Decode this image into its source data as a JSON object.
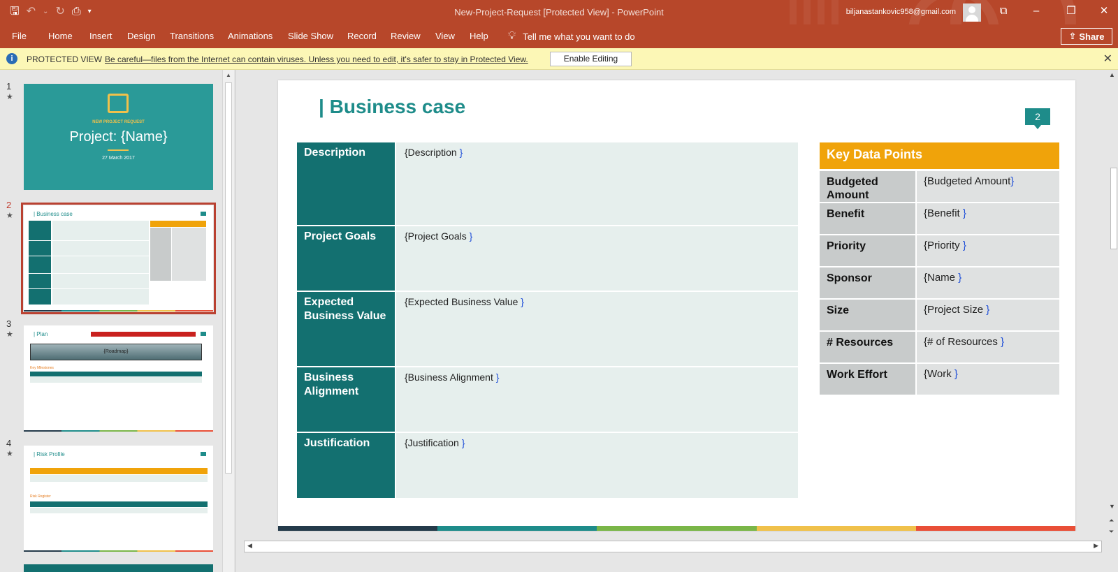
{
  "titlebar": {
    "document_title": "New-Project-Request  [Protected View]  -  PowerPoint",
    "user_email": "biljanastankovic958@gmail.com",
    "icons": [
      "save-icon",
      "undo-icon",
      "redo-icon",
      "present-icon",
      "customize-icon"
    ]
  },
  "ribbon": {
    "tabs": [
      "File",
      "Home",
      "Insert",
      "Design",
      "Transitions",
      "Animations",
      "Slide Show",
      "Record",
      "Review",
      "View",
      "Help"
    ],
    "tell_me": "Tell me what you want to do",
    "share_label": "Share"
  },
  "protected_view": {
    "label": "PROTECTED VIEW",
    "message": "Be careful—files from the Internet can contain viruses. Unless you need to edit, it's safer to stay in Protected View.",
    "enable_label": "Enable Editing"
  },
  "thumbnails": {
    "numbers": [
      "1",
      "2",
      "3",
      "4"
    ],
    "star": "★",
    "slide1": {
      "subtitle": "NEW PROJECT REQUEST",
      "title": "Project: {Name}",
      "date": "27 March 2017"
    },
    "slide2": {
      "title": "| Business case"
    },
    "slide3": {
      "title": "| Plan",
      "roadmap": "{Roadmap}",
      "milestone": "Key Milestones"
    },
    "slide4": {
      "title": "| Risk Profile",
      "register": "Risk Register"
    }
  },
  "slide": {
    "title": "| Business case",
    "page_badge": "2",
    "business_case": [
      {
        "label": "Description",
        "value": "{Description }"
      },
      {
        "label": "Project Goals",
        "value": "{Project Goals }"
      },
      {
        "label": "Expected Business Value",
        "value": "{Expected Business Value }"
      },
      {
        "label": "Business Alignment",
        "value": "{Business Alignment }"
      },
      {
        "label": "Justification",
        "value": "{Justification }"
      }
    ],
    "key_data_title": "Key Data Points",
    "key_data": [
      {
        "label": "Budgeted Amount",
        "value": "{Budgeted Amount}"
      },
      {
        "label": "Benefit",
        "value": "{Benefit }"
      },
      {
        "label": "Priority",
        "value": "{Priority }"
      },
      {
        "label": "Sponsor",
        "value": "{Name }"
      },
      {
        "label": "Size",
        "value": "{Project Size }"
      },
      {
        "label": "# Resources",
        "value": "{# of Resources }"
      },
      {
        "label": "Work Effort",
        "value": "{Work }"
      }
    ],
    "stripe_colors": [
      "#243a4a",
      "#1e8c8a",
      "#7ab648",
      "#f0c14b",
      "#e94f37"
    ]
  },
  "colors": {
    "titlebar": "#b7472a",
    "teal": "#137070",
    "accent_orange": "#f0a30a",
    "protected_bg": "#fcf7b6"
  }
}
